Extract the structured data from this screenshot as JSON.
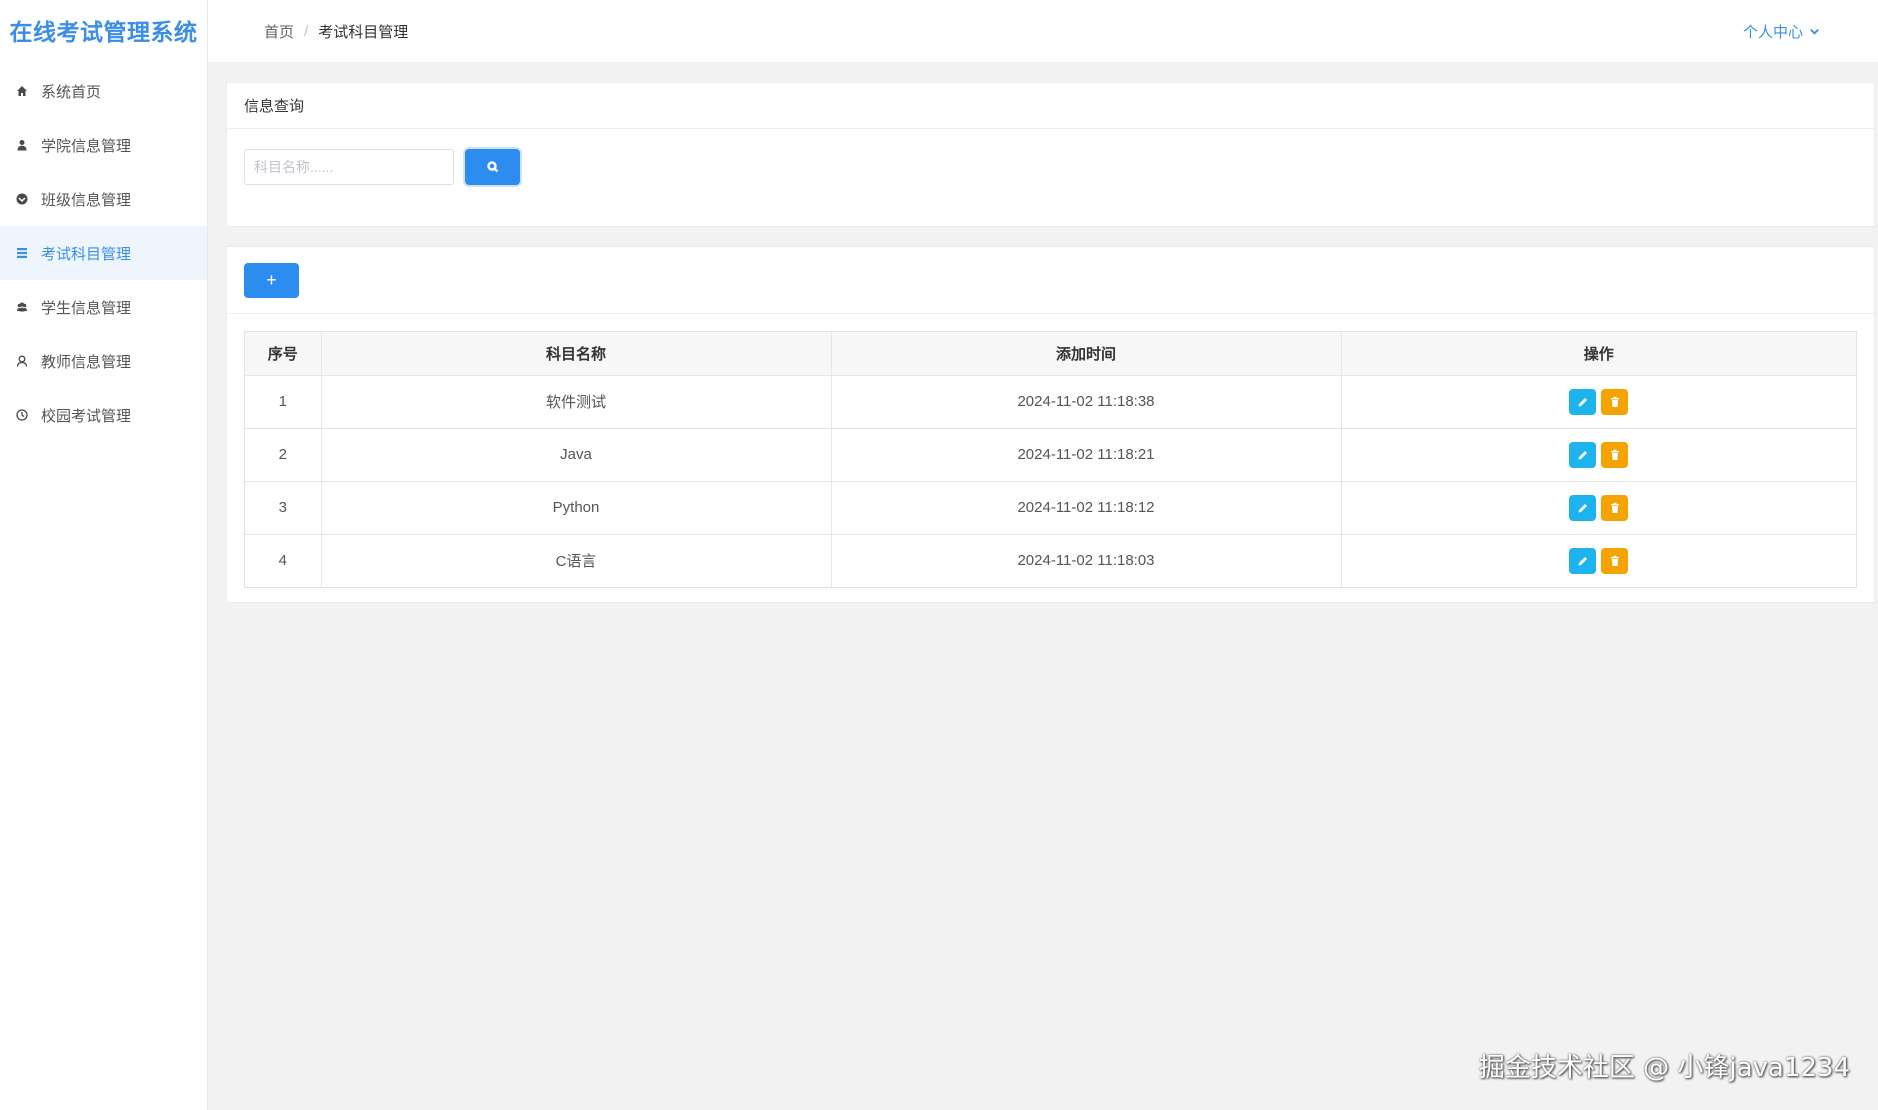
{
  "app": {
    "title": "在线考试管理系统"
  },
  "sidebar": {
    "items": [
      {
        "label": "系统首页",
        "icon": "home-icon",
        "active": false
      },
      {
        "label": "学院信息管理",
        "icon": "user-tie-icon",
        "active": false
      },
      {
        "label": "班级信息管理",
        "icon": "circle-icon",
        "active": false
      },
      {
        "label": "考试科目管理",
        "icon": "list-icon",
        "active": true
      },
      {
        "label": "学生信息管理",
        "icon": "users-icon",
        "active": false
      },
      {
        "label": "教师信息管理",
        "icon": "teacher-icon",
        "active": false
      },
      {
        "label": "校园考试管理",
        "icon": "clock-icon",
        "active": false
      }
    ]
  },
  "header": {
    "breadcrumb": {
      "home": "首页",
      "separator": "/",
      "current": "考试科目管理"
    },
    "user_menu": "个人中心"
  },
  "search": {
    "panel_title": "信息查询",
    "placeholder": "科目名称......",
    "value": ""
  },
  "toolbar": {
    "add_label": "+"
  },
  "table": {
    "headers": {
      "index": "序号",
      "name": "科目名称",
      "time": "添加时间",
      "ops": "操作"
    },
    "rows": [
      {
        "index": "1",
        "name": "软件测试",
        "time": "2024-11-02 11:18:38"
      },
      {
        "index": "2",
        "name": "Java",
        "time": "2024-11-02 11:18:21"
      },
      {
        "index": "3",
        "name": "Python",
        "time": "2024-11-02 11:18:12"
      },
      {
        "index": "4",
        "name": "C语言",
        "time": "2024-11-02 11:18:03"
      }
    ]
  },
  "colors": {
    "primary": "#2d8cf0",
    "edit": "#1fb3ee",
    "delete": "#f5a300",
    "brand": "#3a8ee6"
  },
  "watermark": "掘金技术社区 @ 小锋java1234"
}
